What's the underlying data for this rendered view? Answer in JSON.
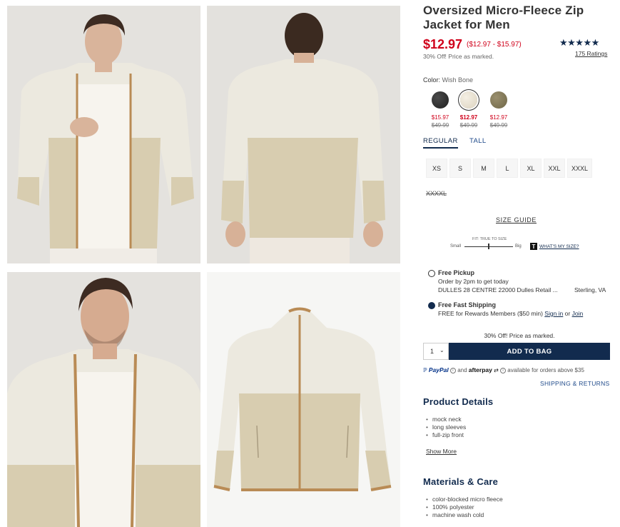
{
  "product": {
    "title": "Oversized Micro-Fleece Zip Jacket for Men",
    "price": "$12.97",
    "price_range": "($12.97 - $15.97)",
    "promo_note": "30% Off! Price as marked.",
    "stars": "★★★★★",
    "ratings_label": "175 Ratings"
  },
  "color": {
    "label": "Color:",
    "selected": "Wish Bone",
    "swatches": [
      {
        "name": "black",
        "hex": "#2b2b2b",
        "price": "$15.97",
        "old_price": "$49.99"
      },
      {
        "name": "wish-bone",
        "hex": "#e9e2d2",
        "price": "$12.97",
        "old_price": "$49.99"
      },
      {
        "name": "olive",
        "hex": "#847b5a",
        "price": "$12.97",
        "old_price": "$49.99"
      }
    ]
  },
  "fit_tabs": [
    "REGULAR",
    "TALL"
  ],
  "sizes": [
    "XS",
    "S",
    "M",
    "L",
    "XL",
    "XXL",
    "XXXL"
  ],
  "sizes_unavailable": [
    "XXXXL"
  ],
  "size_guide": {
    "label": "SIZE GUIDE",
    "fit_title": "FIT: TRUE TO SIZE",
    "small": "Small",
    "big": "Big",
    "badge": "T",
    "whats_my_size": "WHAT'S MY SIZE?",
    "fit_level": 0.5
  },
  "fulfillment": {
    "pickup_title": "Free Pickup",
    "pickup_line1": "Order by 2pm to get today",
    "pickup_store": "DULLES 28 CENTRE 22000 Dulles Retail ...",
    "pickup_city": "Sterling, VA",
    "shipping_title": "Free Fast Shipping",
    "shipping_text": "FREE for Rewards Members ($50 min)",
    "sign_in": "Sign in",
    "or": "or",
    "join": "Join"
  },
  "cart": {
    "promo": "30% Off! Price as marked.",
    "qty": "1",
    "add_label": "ADD TO BAG"
  },
  "payment": {
    "paypal": "PayPal",
    "and": "and",
    "afterpay": "afterpay",
    "afterpay_note": "available for orders above $35",
    "shipping_returns": "SHIPPING & RETURNS"
  },
  "details": {
    "title": "Product Details",
    "items": [
      "mock neck",
      "long sleeves",
      "full-zip front"
    ],
    "show_more": "Show More"
  },
  "materials": {
    "title": "Materials & Care",
    "items": [
      "color-blocked micro fleece",
      "100% polyester",
      "machine wash cold"
    ]
  },
  "colors": {
    "accent_navy": "#122b4e",
    "sale_red": "#d0021b",
    "jacket_top": "#ece9df",
    "jacket_bottom": "#d8cdb0",
    "trim": "#b98b55"
  }
}
